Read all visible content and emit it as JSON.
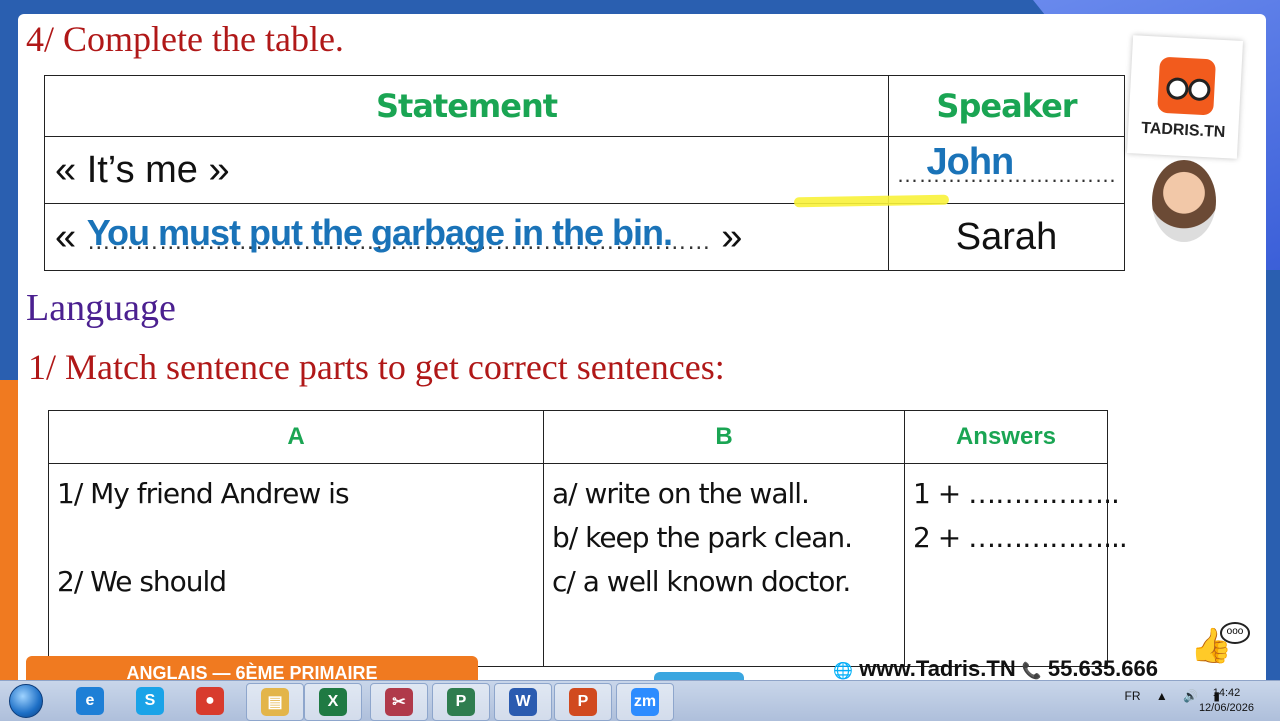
{
  "slide": {
    "title": "4/ Complete the table.",
    "table1": {
      "headers": [
        "Statement",
        "Speaker"
      ],
      "rows": [
        {
          "statement_open": "« It’s me »",
          "speaker_dots": "…………………………",
          "speaker_answer": "John"
        },
        {
          "statement_quote_open": "«",
          "statement_dots": "……………………………………………………………………",
          "statement_answer": "You must put the garbage in the bin.",
          "statement_quote_close": "»",
          "speaker": "Sarah"
        }
      ]
    },
    "section": "Language",
    "subtitle": "1/ Match sentence parts to get correct sentences:",
    "table2": {
      "headers": [
        "A",
        "B",
        "Answers"
      ],
      "col_a": [
        "1/ My friend Andrew is",
        "2/ We should"
      ],
      "col_b": [
        "a/ write on the wall.",
        "b/ keep the park clean.",
        "c/ a well known doctor."
      ],
      "answers": [
        "1 + ……………..",
        "2 + ……………..."
      ]
    },
    "logo_text": "TADRIS.TN",
    "footer_label": "ANGLAIS — 6ÈME PRIMAIRE",
    "footer_site": "www.Tadris.TN",
    "footer_phone": "55.635.666"
  },
  "taskbar": {
    "apps": [
      {
        "name": "internet-explorer",
        "glyph": "e",
        "color": "#1e7fd6"
      },
      {
        "name": "skype",
        "glyph": "S",
        "color": "#1aa3e8"
      },
      {
        "name": "chrome",
        "glyph": "●",
        "color": "#d83b2d"
      },
      {
        "name": "file-explorer",
        "glyph": "▤",
        "color": "#e3b54a"
      },
      {
        "name": "excel",
        "glyph": "X",
        "color": "#1f7a43"
      },
      {
        "name": "snipping-tool",
        "glyph": "✂",
        "color": "#b03a4a"
      },
      {
        "name": "project",
        "glyph": "P",
        "color": "#2f7d4f"
      },
      {
        "name": "word",
        "glyph": "W",
        "color": "#2a5bb0"
      },
      {
        "name": "powerpoint",
        "glyph": "P",
        "color": "#d14a1f"
      },
      {
        "name": "zoom",
        "glyph": "zm",
        "color": "#2d8cff"
      }
    ],
    "language": "FR",
    "time": "14:42",
    "date": "12/06/2026"
  }
}
